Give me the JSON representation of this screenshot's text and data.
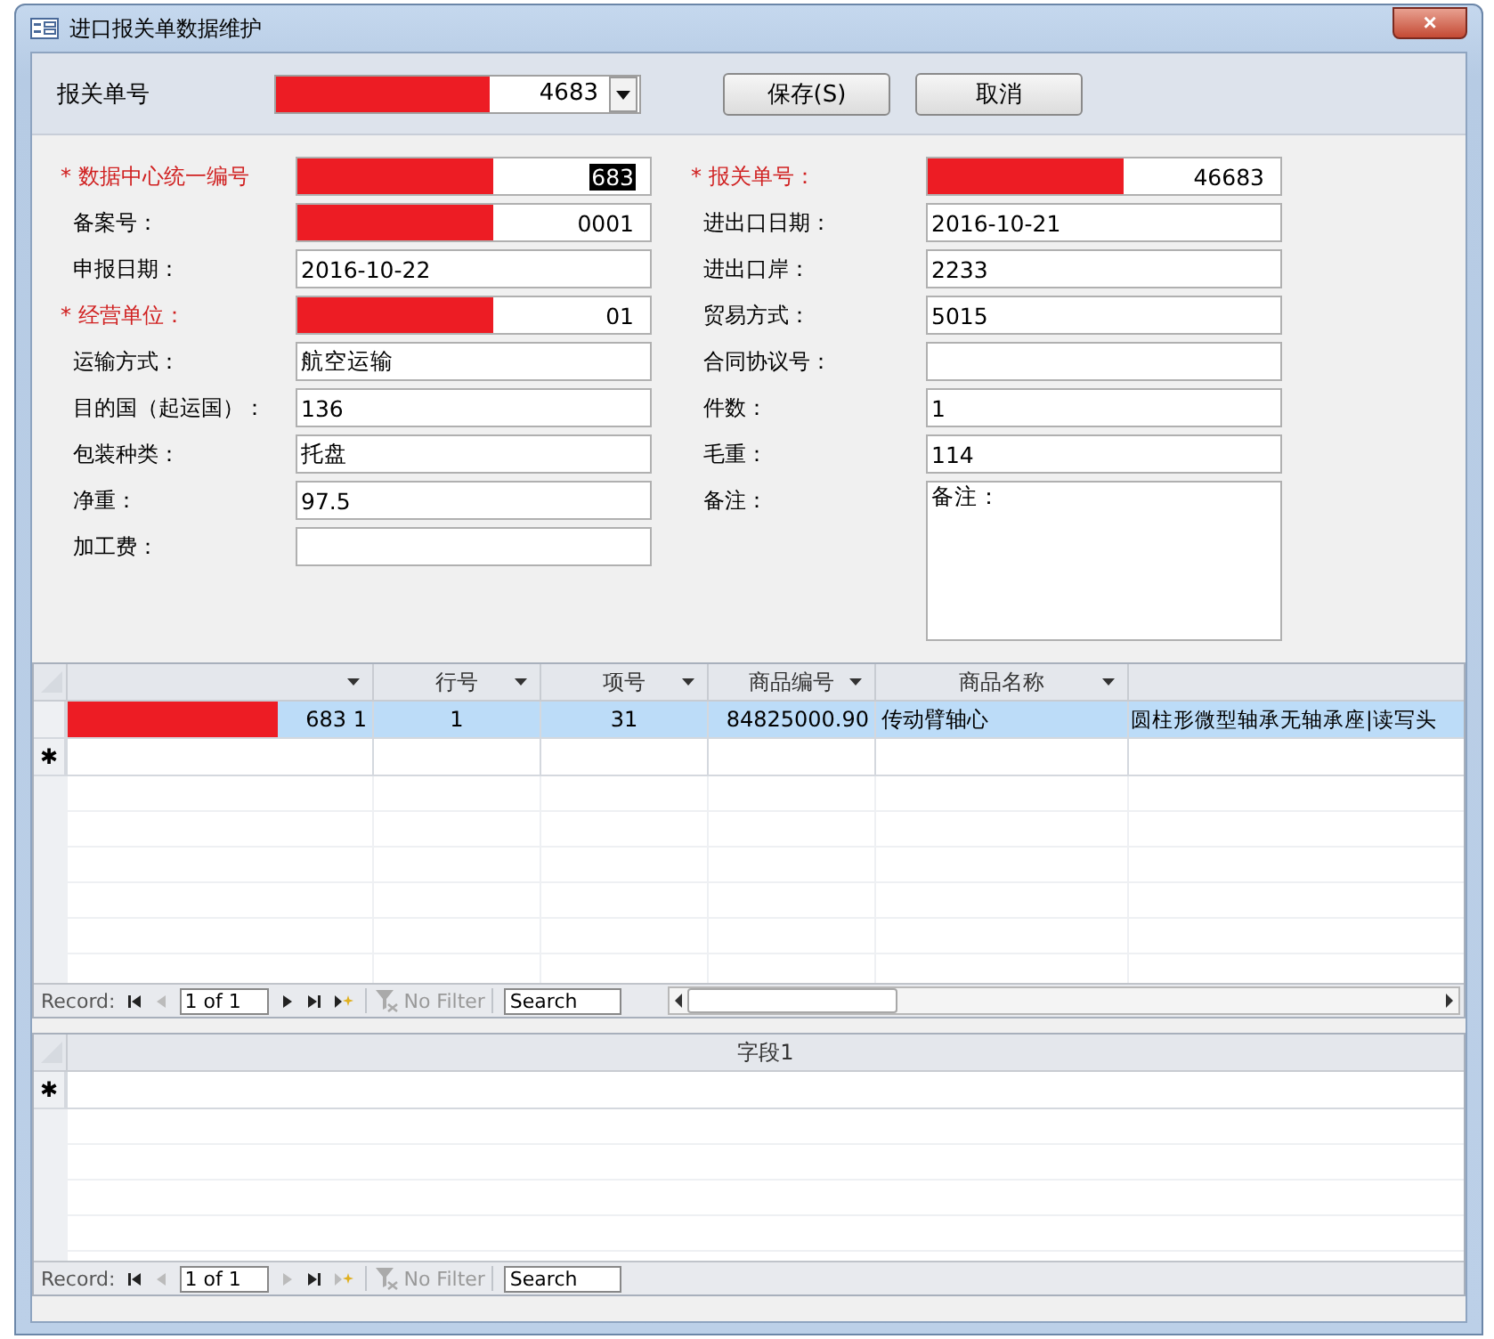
{
  "window": {
    "title": "进口报关单数据维护",
    "close": "×"
  },
  "header": {
    "label": "报关单号",
    "combo_value": "4683",
    "combo_redacted": true,
    "buttons": [
      "保存(S)",
      "取消"
    ]
  },
  "form": {
    "left": [
      {
        "label": "* 数据中心统一编号",
        "required": true,
        "value": "683",
        "highlighted": true,
        "redacted": true
      },
      {
        "label": "备案号：",
        "required": false,
        "value": "0001",
        "highlighted": false,
        "redacted": true
      },
      {
        "label": "申报日期：",
        "required": false,
        "value": "2016-10-22",
        "highlighted": false,
        "redacted": false
      },
      {
        "label": "* 经营单位：",
        "required": true,
        "value": "01",
        "highlighted": false,
        "redacted": true
      },
      {
        "label": "运输方式：",
        "required": false,
        "value": "航空运输",
        "highlighted": false,
        "redacted": false
      },
      {
        "label": "目的国（起运国）：",
        "required": false,
        "value": "136",
        "highlighted": false,
        "redacted": false
      },
      {
        "label": "包装种类：",
        "required": false,
        "value": "托盘",
        "highlighted": false,
        "redacted": false
      },
      {
        "label": "净重：",
        "required": false,
        "value": "97.5",
        "highlighted": false,
        "redacted": false
      },
      {
        "label": "加工费：",
        "required": false,
        "redacted": false
      }
    ],
    "right": [
      {
        "label": "* 报关单号：",
        "required": true,
        "value": "46683",
        "highlighted": false,
        "redacted": true
      },
      {
        "label": "进出口日期：",
        "required": false,
        "value": "2016-10-21",
        "highlighted": false,
        "redacted": false
      },
      {
        "label": "进出口岸：",
        "required": false,
        "value": "2233",
        "highlighted": false,
        "redacted": false
      },
      {
        "label": "贸易方式：",
        "required": false,
        "value": "5015",
        "highlighted": false,
        "redacted": false
      },
      {
        "label": "合同协议号：",
        "required": false,
        "redacted": false
      },
      {
        "label": "件数：",
        "required": false,
        "value": "1",
        "highlighted": false,
        "redacted": false
      },
      {
        "label": "毛重：",
        "required": false,
        "value": "114",
        "highlighted": false,
        "redacted": false
      },
      {
        "label": "备注：",
        "required": false,
        "value": "备注：",
        "highlighted": false,
        "redacted": false,
        "kind": "memo"
      }
    ]
  },
  "grids": [
    {
      "columns": [
        {
          "dropdown": true
        },
        {
          "label": "行号",
          "dropdown": true
        },
        {
          "label": "项号",
          "dropdown": true
        },
        {
          "label": "商品编号",
          "dropdown": true
        },
        {
          "label": "商品名称",
          "dropdown": true
        },
        {
          "dropdown": false
        }
      ],
      "rows": [
        {
          "selected": true,
          "redacted": true,
          "cells": [
            "683 1",
            "1",
            "31",
            "84825000.90",
            "传动臂轴心",
            "圆柱形微型轴承无轴承座|读写头"
          ]
        }
      ],
      "new_row_marker": "✱",
      "nav": {
        "record_label": "Record:",
        "position": "1 of 1",
        "prev_enabled": false,
        "next_enabled": true,
        "filter": "No Filter",
        "search_placeholder": "Search",
        "hscroll": true
      }
    },
    {
      "columns": [
        {
          "label": "字段1",
          "dropdown": false
        }
      ],
      "new_row_marker": "✱",
      "nav": {
        "record_label": "Record:",
        "position": "1 of 1",
        "prev_enabled": false,
        "next_enabled": false,
        "filter": "No Filter",
        "search_placeholder": "Search",
        "hscroll": false
      }
    }
  ]
}
